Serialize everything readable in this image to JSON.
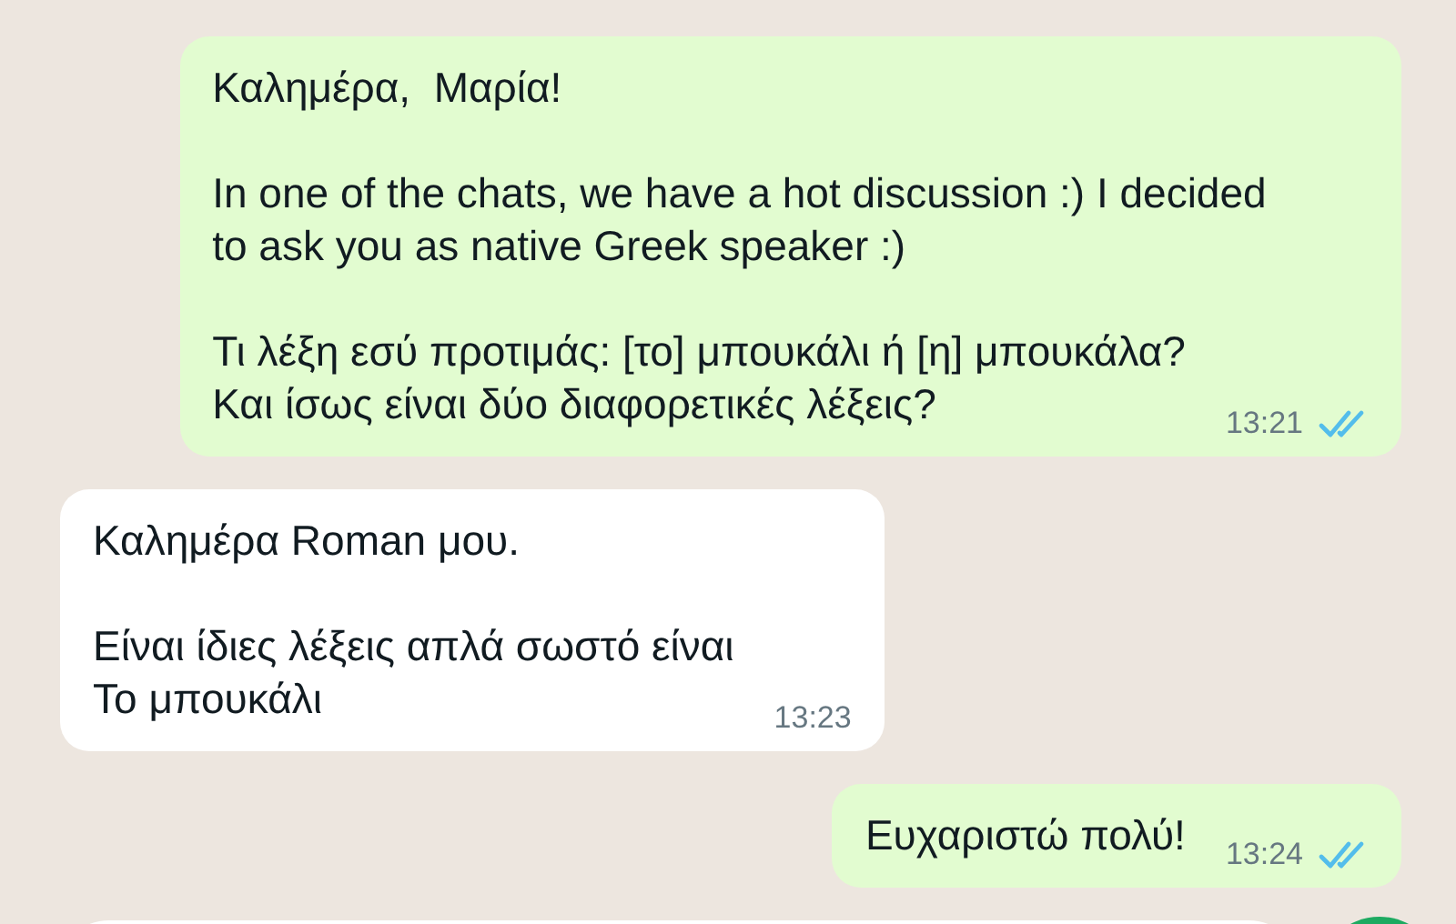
{
  "messages": [
    {
      "kind": "sent",
      "paragraphs": [
        "Καλημέρα,  Μαρία!",
        "In one of the chats, we have a hot discussion :) I decided\nto ask you as native Greek speaker :)",
        "Τι λέξη εσύ προτιμάς: [το] μπουκάλι ή [η] μπουκάλα?\nΚαι ίσως είναι δύο διαφορετικές λέξεις?"
      ],
      "time": "13:21",
      "read": true
    },
    {
      "kind": "received",
      "paragraphs": [
        "Καλημέρα Roman μου.",
        "Είναι ίδιες λέξεις απλά σωστό είναι\nΤο μπουκάλι"
      ],
      "time": "13:23"
    },
    {
      "kind": "sent",
      "paragraphs": [
        "Ευχαριστώ πολύ!"
      ],
      "time": "13:24",
      "read": true
    }
  ]
}
